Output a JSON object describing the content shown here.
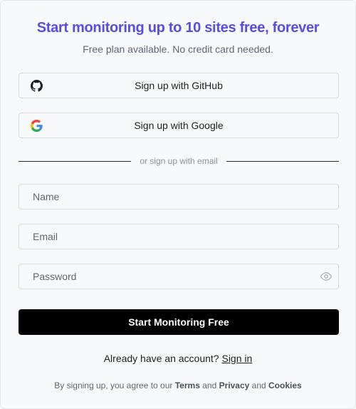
{
  "header": {
    "title": "Start monitoring up to 10 sites free, forever",
    "subtitle": "Free plan available. No credit card needed."
  },
  "oauth": {
    "github_label": "Sign up with GitHub",
    "google_label": "Sign up with Google"
  },
  "divider_text": "or sign up with email",
  "form": {
    "name_placeholder": "Name",
    "email_placeholder": "Email",
    "password_placeholder": "Password",
    "submit_label": "Start Monitoring Free"
  },
  "signin": {
    "prompt": "Already have an account?",
    "link": "Sign in"
  },
  "legal": {
    "prefix": "By signing up, you agree to our",
    "terms": "Terms",
    "privacy": "Privacy",
    "and": "and",
    "cookies": "Cookies"
  },
  "colors": {
    "accent": "#5b4be0",
    "submit_bg": "#000000",
    "card_bg": "#f8f9fb"
  },
  "icons": {
    "github": "github-icon",
    "google": "google-icon",
    "password_toggle": "eye-icon"
  }
}
